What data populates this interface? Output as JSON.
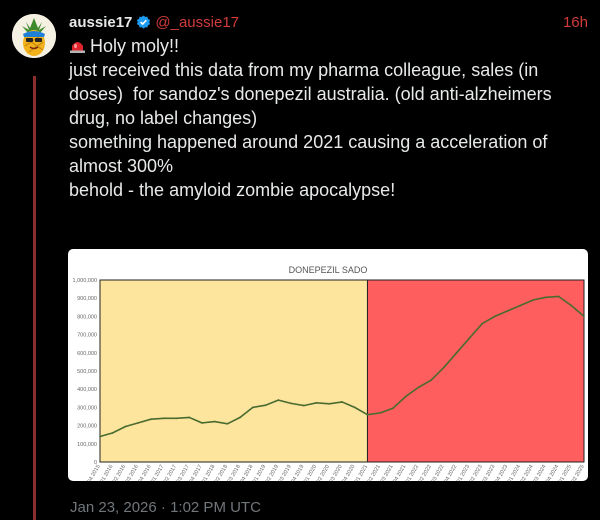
{
  "post": {
    "display_name": "aussie17",
    "handle": "@_aussie17",
    "time_ago": "16h",
    "lines": [
      "Holy moly!!",
      "just received this data from my pharma colleague, sales (in doses)  for sandoz's donepezil australia. (old anti-alzheimers drug, no label changes)",
      "",
      "something happened around 2021 causing a acceleration of almost 300%",
      "",
      "behold - the amyloid zombie apocalypse!"
    ],
    "timestamp": "Jan 23, 2026 · 1:02 PM UTC",
    "icons": {
      "verified": "verified-badge-icon",
      "siren": "siren-icon",
      "avatar": "pineapple-avatar-icon"
    },
    "colors": {
      "accent": "#d33b3b",
      "verified": "#1d9bf0",
      "thread_line": "#8b2e2e"
    }
  },
  "chart_data": {
    "type": "line",
    "title": "DONEPEZIL   SADO",
    "xlabel": "",
    "ylabel": "",
    "ylim": [
      0,
      1000000
    ],
    "yticks": [
      "0",
      "100,000",
      "200,000",
      "300,000",
      "400,000",
      "500,000",
      "600,000",
      "700,000",
      "800,000",
      "900,000",
      "1,000,000"
    ],
    "categories": [
      "Q4 2015",
      "Q1 2016",
      "Q2 2016",
      "Q3 2016",
      "Q4 2016",
      "Q1 2017",
      "Q2 2017",
      "Q3 2017",
      "Q4 2017",
      "Q1 2018",
      "Q2 2018",
      "Q3 2018",
      "Q4 2018",
      "Q1 2019",
      "Q2 2019",
      "Q3 2019",
      "Q4 2019",
      "Q1 2020",
      "Q2 2020",
      "Q3 2020",
      "Q4 2020",
      "Q1 2021",
      "Q2 2021",
      "Q3 2021",
      "Q4 2021",
      "Q1 2022",
      "Q2 2022",
      "Q3 2022",
      "Q4 2022",
      "Q1 2023",
      "Q2 2023",
      "Q3 2023",
      "Q4 2023",
      "Q1 2024",
      "Q2 2024",
      "Q3 2024",
      "Q4 2024",
      "Q1 2025",
      "Q2 2025"
    ],
    "values": [
      140000,
      160000,
      195000,
      215000,
      235000,
      240000,
      240000,
      245000,
      215000,
      222000,
      210000,
      245000,
      300000,
      312000,
      340000,
      322000,
      310000,
      325000,
      320000,
      330000,
      300000,
      260000,
      270000,
      295000,
      360000,
      410000,
      450000,
      520000,
      600000,
      680000,
      760000,
      800000,
      830000,
      860000,
      890000,
      905000,
      910000,
      860000,
      800000
    ],
    "regions": [
      {
        "from": "Q4 2015",
        "to": "Q1 2021",
        "color": "#fde59d"
      },
      {
        "from": "Q1 2021",
        "to": "Q2 2025",
        "color": "#ff5e5e"
      }
    ],
    "line_color": "#4a6b30",
    "grid": false,
    "legend": "none"
  }
}
